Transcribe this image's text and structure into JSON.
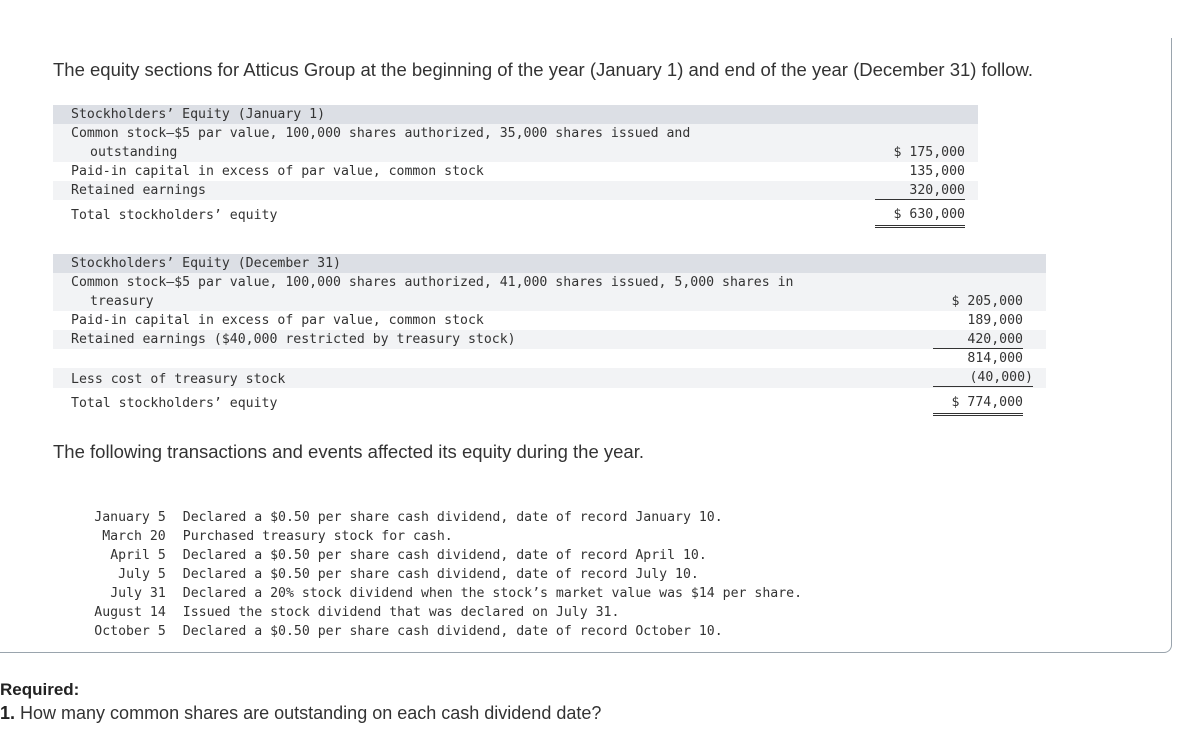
{
  "intro": "The equity sections for Atticus Group at the beginning of the year (January 1) and end of the year (December 31) follow.",
  "jan_table": {
    "header": "Stockholders’ Equity (January 1)",
    "common_stock_line1": "Common stock—$5 par value, 100,000 shares authorized, 35,000 shares issued and",
    "common_stock_line2": "outstanding",
    "common_stock_amount": "$ 175,000",
    "paid_in_label": "Paid-in capital in excess of par value, common stock",
    "paid_in_amount": "135,000",
    "retained_label": "Retained earnings",
    "retained_amount": "320,000",
    "total_label": "Total stockholders’ equity",
    "total_amount": "$ 630,000"
  },
  "dec_table": {
    "header": "Stockholders’ Equity (December 31)",
    "common_stock_line1": "Common stock—$5 par value, 100,000 shares authorized, 41,000 shares issued, 5,000 shares in",
    "common_stock_line2": "treasury",
    "common_stock_amount": "$ 205,000",
    "paid_in_label": "Paid-in capital in excess of par value, common stock",
    "paid_in_amount": "189,000",
    "retained_label": "Retained earnings ($40,000 restricted by treasury stock)",
    "retained_amount": "420,000",
    "subtotal_amount": "814,000",
    "treasury_label": "Less cost of treasury stock",
    "treasury_amount": "(40,000)",
    "total_label": "Total stockholders’ equity",
    "total_amount": "$ 774,000"
  },
  "transactions_intro": "The following transactions and events affected its equity during the year.",
  "transactions": [
    {
      "date": "January 5",
      "description": "Declared a $0.50 per share cash dividend, date of record January 10."
    },
    {
      "date": "March 20",
      "description": "Purchased treasury stock for cash."
    },
    {
      "date": "April 5",
      "description": "Declared a $0.50 per share cash dividend, date of record April 10."
    },
    {
      "date": "July 5",
      "description": "Declared a $0.50 per share cash dividend, date of record July 10."
    },
    {
      "date": "July 31",
      "description": "Declared a 20% stock dividend when the stock’s market value was $14 per share."
    },
    {
      "date": "August 14",
      "description": "Issued the stock dividend that was declared on July 31."
    },
    {
      "date": "October 5",
      "description": "Declared a $0.50 per share cash dividend, date of record October 10."
    }
  ],
  "required_label": "Required:",
  "question_number": "1.",
  "question_text": "How many common shares are outstanding on each cash dividend date?"
}
